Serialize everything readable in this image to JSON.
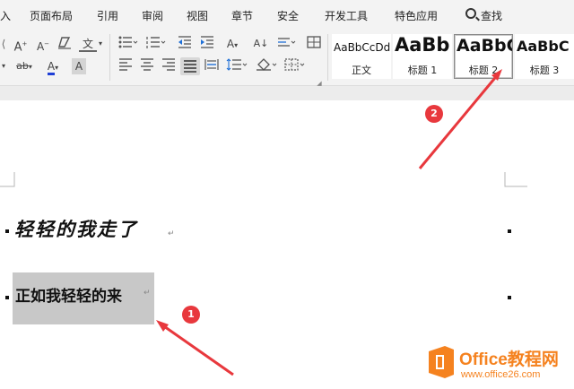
{
  "menu": {
    "items": [
      "入",
      "页面布局",
      "引用",
      "审阅",
      "视图",
      "章节",
      "安全",
      "开发工具",
      "特色应用"
    ],
    "search_label": "查找"
  },
  "ribbon": {
    "font_buttons": {
      "grow_font": "A",
      "shrink_font": "A",
      "phonetic": "文",
      "font_color": "A",
      "char_shading": "A",
      "sort": "A↓",
      "case": "A"
    },
    "styles": [
      {
        "sample": "AaBbCcDd",
        "name": "正文"
      },
      {
        "sample": "AaBb",
        "name": "标题 1"
      },
      {
        "sample": "AaBbC",
        "name": "标题 2"
      },
      {
        "sample": "AaBbC",
        "name": "标题 3"
      }
    ]
  },
  "document": {
    "line1": "轻轻的我走了",
    "line2": "正如我轻轻的来",
    "paragraph_mark": "↵"
  },
  "annotations": {
    "badge1": "1",
    "badge2": "2"
  },
  "watermark": {
    "brand": "Office教程网",
    "url": "www.office26.com"
  },
  "colors": {
    "accent_red": "#e8383d",
    "watermark_orange": "#f5821f",
    "font_color_underline": "#1f3fd6",
    "selection_gray": "#c8c8c8"
  }
}
